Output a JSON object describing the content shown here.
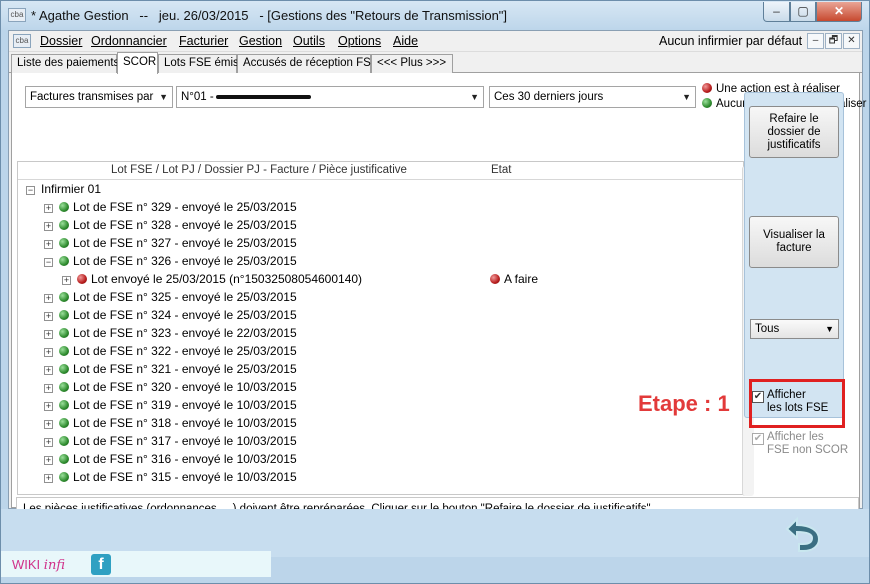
{
  "window": {
    "icon_label": "cba",
    "title": "* Agathe Gestion   --   jeu. 26/03/2015   - [Gestions des \"Retours de Transmission\"]",
    "controls": {
      "minimize": "–",
      "maximize": "▢",
      "close": "✕"
    }
  },
  "menu": {
    "icon_label": "cba",
    "items": [
      "Dossier",
      "Ordonnancier",
      "Facturier",
      "Gestion",
      "Outils",
      "Options",
      "Aide"
    ],
    "right_label": "Aucun infirmier par défaut",
    "mdi": {
      "minimize": "–",
      "restore": "🗗",
      "close": "✕"
    }
  },
  "tabs": [
    {
      "label": "Liste des paiements",
      "active": false
    },
    {
      "label": "SCOR",
      "active": true
    },
    {
      "label": "Lots FSE émis",
      "active": false
    },
    {
      "label": "Accusés de réception FSE",
      "active": false
    },
    {
      "label": "<<< Plus >>>",
      "active": false
    }
  ],
  "filters": {
    "type": {
      "value": "Factures transmises par"
    },
    "person": {
      "value": "N°01 -"
    },
    "period": {
      "value": "Ces 30 derniers jours"
    }
  },
  "legend": {
    "red": "Une action est à réaliser",
    "green": "Aucune action n'est à réaliser",
    "colors": {
      "red": "#b71c1c",
      "green": "#2e8b2e"
    }
  },
  "list": {
    "columns": [
      "Lot FSE / Lot PJ / Dossier PJ - Facture / Pièce justificative",
      "Etat"
    ],
    "root": "Infirmier 01",
    "rows": [
      {
        "label": "Lot de FSE n° 329 - envoyé le 25/03/2015",
        "status": "green",
        "expand": "+"
      },
      {
        "label": "Lot de FSE n° 328 - envoyé le 25/03/2015",
        "status": "green",
        "expand": "+"
      },
      {
        "label": "Lot de FSE n° 327 - envoyé le 25/03/2015",
        "status": "green",
        "expand": "+"
      },
      {
        "label": "Lot de FSE n° 326 - envoyé le 25/03/2015",
        "status": "green",
        "expand": "−"
      },
      {
        "label": "Lot envoyé le 25/03/2015 (n°15032508054600140)",
        "status": "red",
        "expand": "+",
        "child": true,
        "state": "A faire"
      },
      {
        "label": "Lot de FSE n° 325 - envoyé le 25/03/2015",
        "status": "green",
        "expand": "+"
      },
      {
        "label": "Lot de FSE n° 324 - envoyé le 25/03/2015",
        "status": "green",
        "expand": "+"
      },
      {
        "label": "Lot de FSE n° 323 - envoyé le 22/03/2015",
        "status": "green",
        "expand": "+"
      },
      {
        "label": "Lot de FSE n° 322 - envoyé le 25/03/2015",
        "status": "green",
        "expand": "+"
      },
      {
        "label": "Lot de FSE n° 321 - envoyé le 25/03/2015",
        "status": "green",
        "expand": "+"
      },
      {
        "label": "Lot de FSE n° 320 - envoyé le 10/03/2015",
        "status": "green",
        "expand": "+"
      },
      {
        "label": "Lot de FSE n° 319 - envoyé le 10/03/2015",
        "status": "green",
        "expand": "+"
      },
      {
        "label": "Lot de FSE n° 318 - envoyé le 10/03/2015",
        "status": "green",
        "expand": "+"
      },
      {
        "label": "Lot de FSE n° 317 - envoyé le 10/03/2015",
        "status": "green",
        "expand": "+"
      },
      {
        "label": "Lot de FSE n° 316 - envoyé le 10/03/2015",
        "status": "green",
        "expand": "+"
      },
      {
        "label": "Lot de FSE n° 315 - envoyé le 10/03/2015",
        "status": "green",
        "expand": "+"
      }
    ]
  },
  "panel": {
    "rebuild_button": "Refaire le dossier de justificatifs",
    "view_button": "Visualiser la facture",
    "filter_select": "Tous",
    "show_lots": {
      "label1": "Afficher",
      "label2": "les lots FSE",
      "checked": true
    },
    "show_non_scor": {
      "label1": "Afficher les",
      "label2": "FSE non SCOR",
      "checked": true,
      "disabled": true
    },
    "collapse_glyph": ">"
  },
  "annotation": {
    "text": "Etape : 1",
    "color": "#e02020"
  },
  "message": "Les pièces justificatives (ordonnances, ...) doivent être repréparées. Cliquer sur le bouton \"Refaire le dossier de justificatifs\"",
  "footer": {
    "wiki": "WIKI",
    "infi": "infi",
    "facebook": "f"
  }
}
